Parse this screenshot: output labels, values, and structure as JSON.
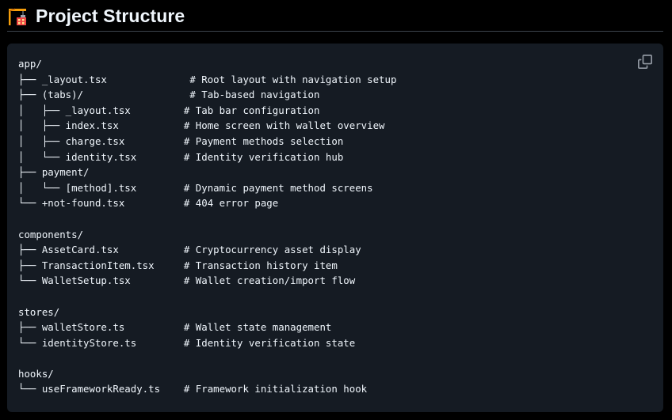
{
  "header": {
    "icon": "construction-crane-icon",
    "title": "Project Structure"
  },
  "code_block": {
    "copy_icon": "copy-icon",
    "lines": [
      "app/",
      "├── _layout.tsx              # Root layout with navigation setup",
      "├── (tabs)/                  # Tab-based navigation",
      "│   ├── _layout.tsx         # Tab bar configuration",
      "│   ├── index.tsx           # Home screen with wallet overview",
      "│   ├── charge.tsx          # Payment methods selection",
      "│   └── identity.tsx        # Identity verification hub",
      "├── payment/",
      "│   └── [method].tsx        # Dynamic payment method screens",
      "└── +not-found.tsx          # 404 error page",
      "",
      "components/",
      "├── AssetCard.tsx           # Cryptocurrency asset display",
      "├── TransactionItem.tsx     # Transaction history item",
      "└── WalletSetup.tsx         # Wallet creation/import flow",
      "",
      "stores/",
      "├── walletStore.ts          # Wallet state management",
      "└── identityStore.ts        # Identity verification state",
      "",
      "hooks/",
      "└── useFrameworkReady.ts    # Framework initialization hook"
    ]
  },
  "colors": {
    "page_background": "#000000",
    "code_background": "#151b23",
    "text": "#f0f6fc",
    "divider": "#3d444d"
  }
}
